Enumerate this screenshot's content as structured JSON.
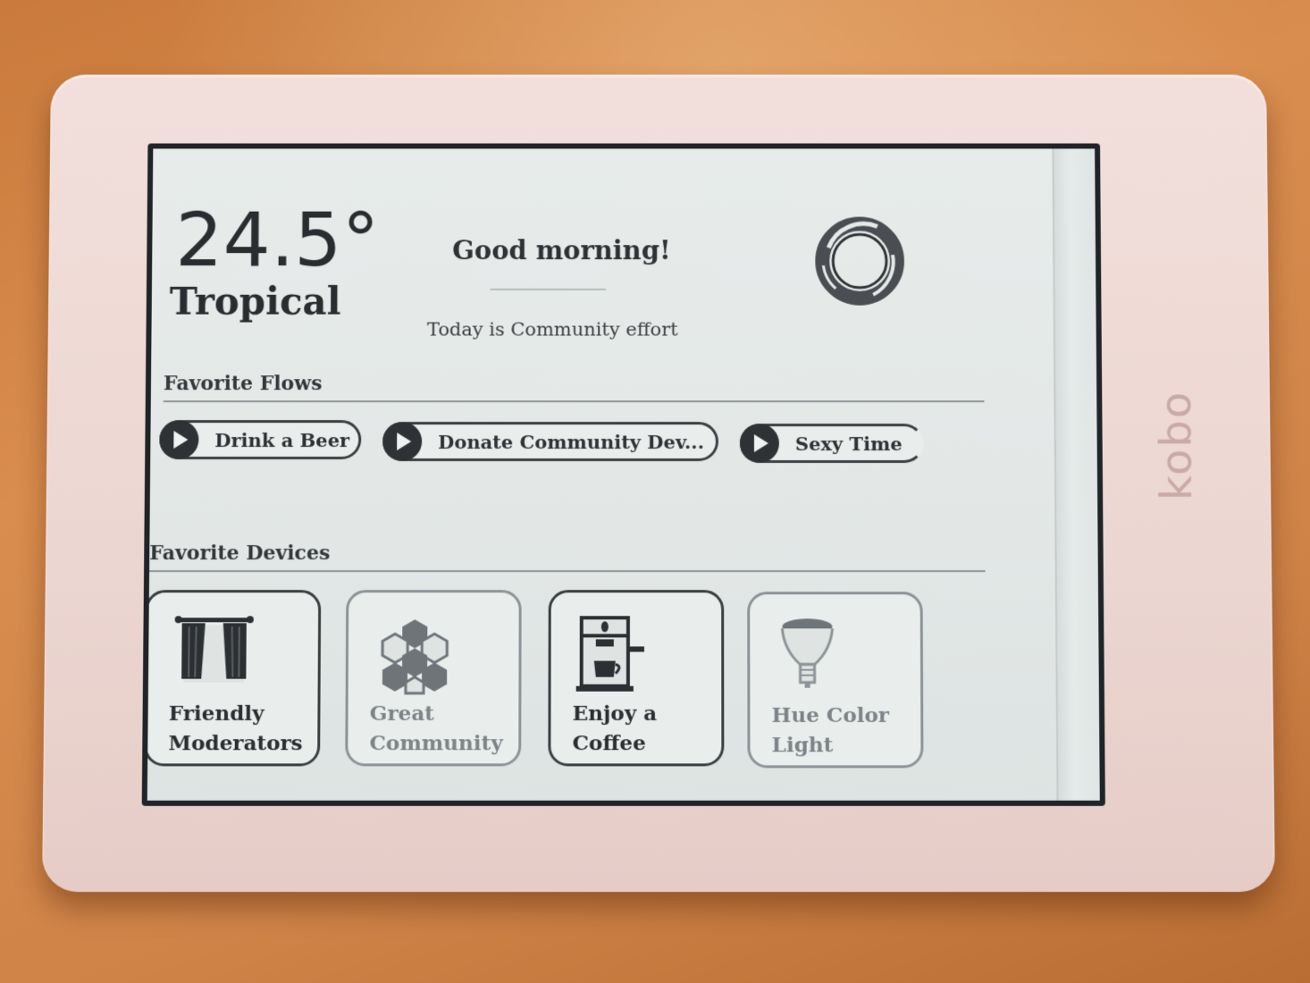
{
  "device": {
    "brand": "kobo"
  },
  "header": {
    "temperature": "24.5°",
    "climate": "Tropical",
    "greeting": "Good morning!",
    "today": "Today is Community effort",
    "logo_icon": "homey-logo-icon"
  },
  "flows": {
    "title": "Favorite Flows",
    "items": [
      {
        "label": "Drink a Beer",
        "icon": "play-icon"
      },
      {
        "label": "Donate Community Dev...",
        "icon": "play-icon"
      },
      {
        "label": "Sexy Time",
        "icon": "play-icon"
      }
    ]
  },
  "devices": {
    "title": "Favorite Devices",
    "items": [
      {
        "line1": "Friendly",
        "line2": "Moderators",
        "icon": "curtains-icon",
        "state": "on"
      },
      {
        "line1": "Great",
        "line2": "Community",
        "icon": "nanoleaf-icon",
        "state": "off"
      },
      {
        "line1": "Enjoy a",
        "line2": "Coffee",
        "icon": "coffee-machine-icon",
        "state": "on"
      },
      {
        "line1": "Hue Color",
        "line2": "Light",
        "icon": "light-bulb-icon",
        "state": "off"
      }
    ]
  },
  "colors": {
    "screen": "#e5eae9",
    "ink": "#2d3033",
    "frame": "#efdbd7",
    "desk": "#d08447"
  }
}
